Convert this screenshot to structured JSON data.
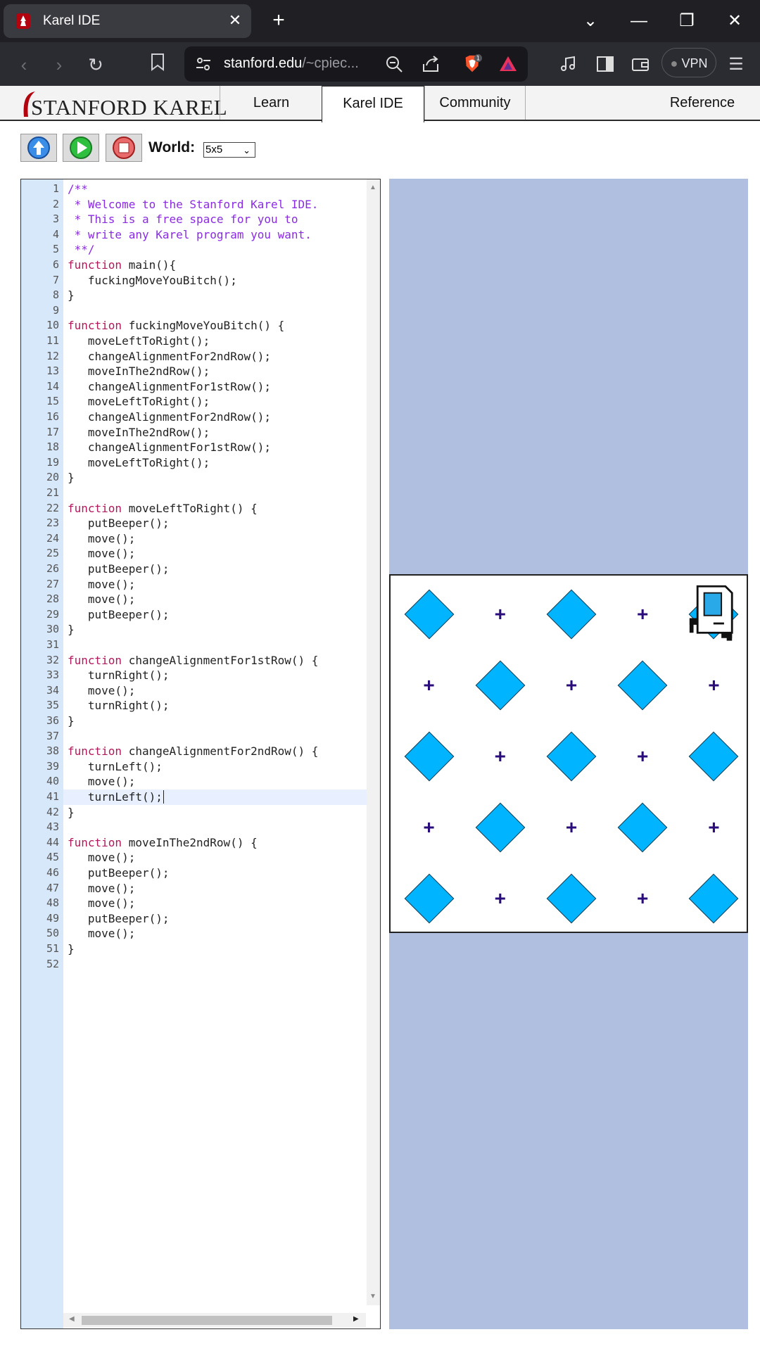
{
  "browser": {
    "tab_title": "Karel IDE",
    "url_host": "stanford.edu",
    "url_path": "/~cpiec...",
    "vpn_label": "VPN",
    "shield_count": "1"
  },
  "site": {
    "logo_text": "STANFORD KAREL",
    "nav": [
      {
        "label": "Learn"
      },
      {
        "label": "Karel IDE"
      },
      {
        "label": "Community"
      },
      {
        "label": "Reference"
      }
    ]
  },
  "controls": {
    "world_label": "World:",
    "world_value": "5x5"
  },
  "editor": {
    "line_numbers": [
      "1",
      "2",
      "3",
      "4",
      "5",
      "6",
      "7",
      "8",
      "9",
      "10",
      "11",
      "12",
      "13",
      "14",
      "15",
      "16",
      "17",
      "18",
      "19",
      "20",
      "21",
      "22",
      "23",
      "24",
      "25",
      "26",
      "27",
      "28",
      "29",
      "30",
      "31",
      "32",
      "33",
      "34",
      "35",
      "36",
      "37",
      "38",
      "39",
      "40",
      "41",
      "42",
      "43",
      "44",
      "45",
      "46",
      "47",
      "48",
      "49",
      "50",
      "51",
      "52"
    ],
    "lines": [
      {
        "kw": "",
        "text": "/**",
        "comment": true
      },
      {
        "kw": "",
        "text": " * Welcome to the Stanford Karel IDE.",
        "comment": true
      },
      {
        "kw": "",
        "text": " * This is a free space for you to",
        "comment": true
      },
      {
        "kw": "",
        "text": " * write any Karel program you want.",
        "comment": true
      },
      {
        "kw": "",
        "text": " **/",
        "comment": true
      },
      {
        "kw": "function",
        "text": " main(){"
      },
      {
        "kw": "",
        "text": "   fuckingMoveYouBitch();"
      },
      {
        "kw": "",
        "text": "}"
      },
      {
        "kw": "",
        "text": ""
      },
      {
        "kw": "function",
        "text": " fuckingMoveYouBitch() {"
      },
      {
        "kw": "",
        "text": "   moveLeftToRight();"
      },
      {
        "kw": "",
        "text": "   changeAlignmentFor2ndRow();"
      },
      {
        "kw": "",
        "text": "   moveInThe2ndRow();"
      },
      {
        "kw": "",
        "text": "   changeAlignmentFor1stRow();"
      },
      {
        "kw": "",
        "text": "   moveLeftToRight();"
      },
      {
        "kw": "",
        "text": "   changeAlignmentFor2ndRow();"
      },
      {
        "kw": "",
        "text": "   moveInThe2ndRow();"
      },
      {
        "kw": "",
        "text": "   changeAlignmentFor1stRow();"
      },
      {
        "kw": "",
        "text": "   moveLeftToRight();"
      },
      {
        "kw": "",
        "text": "}"
      },
      {
        "kw": "",
        "text": ""
      },
      {
        "kw": "function",
        "text": " moveLeftToRight() {"
      },
      {
        "kw": "",
        "text": "   putBeeper();"
      },
      {
        "kw": "",
        "text": "   move();"
      },
      {
        "kw": "",
        "text": "   move();"
      },
      {
        "kw": "",
        "text": "   putBeeper();"
      },
      {
        "kw": "",
        "text": "   move();"
      },
      {
        "kw": "",
        "text": "   move();"
      },
      {
        "kw": "",
        "text": "   putBeeper();"
      },
      {
        "kw": "",
        "text": "}"
      },
      {
        "kw": "",
        "text": ""
      },
      {
        "kw": "function",
        "text": " changeAlignmentFor1stRow() {"
      },
      {
        "kw": "",
        "text": "   turnRight();"
      },
      {
        "kw": "",
        "text": "   move();"
      },
      {
        "kw": "",
        "text": "   turnRight();"
      },
      {
        "kw": "",
        "text": "}"
      },
      {
        "kw": "",
        "text": ""
      },
      {
        "kw": "function",
        "text": " changeAlignmentFor2ndRow() {"
      },
      {
        "kw": "",
        "text": "   turnLeft();"
      },
      {
        "kw": "",
        "text": "   move();"
      },
      {
        "kw": "",
        "text": "   turnLeft();"
      },
      {
        "kw": "",
        "text": "}"
      },
      {
        "kw": "",
        "text": ""
      },
      {
        "kw": "function",
        "text": " moveInThe2ndRow() {"
      },
      {
        "kw": "",
        "text": "   move();"
      },
      {
        "kw": "",
        "text": "   putBeeper();"
      },
      {
        "kw": "",
        "text": "   move();"
      },
      {
        "kw": "",
        "text": "   move();"
      },
      {
        "kw": "",
        "text": "   putBeeper();"
      },
      {
        "kw": "",
        "text": "   move();"
      },
      {
        "kw": "",
        "text": "}"
      },
      {
        "kw": "",
        "text": ""
      }
    ],
    "active_line": 41
  },
  "world_grid": {
    "rows": 5,
    "cols": 5,
    "cells": [
      [
        "beeper",
        "corner",
        "beeper",
        "corner",
        "karel"
      ],
      [
        "corner",
        "beeper",
        "corner",
        "beeper",
        "corner"
      ],
      [
        "beeper",
        "corner",
        "beeper",
        "corner",
        "beeper"
      ],
      [
        "corner",
        "beeper",
        "corner",
        "beeper",
        "corner"
      ],
      [
        "beeper",
        "corner",
        "beeper",
        "corner",
        "beeper"
      ]
    ]
  },
  "colors": {
    "beeper": "#00b4ff",
    "corner": "#2a0c7a",
    "world_bg": "#b0bfe0",
    "gutter": "#d8e8fb"
  }
}
